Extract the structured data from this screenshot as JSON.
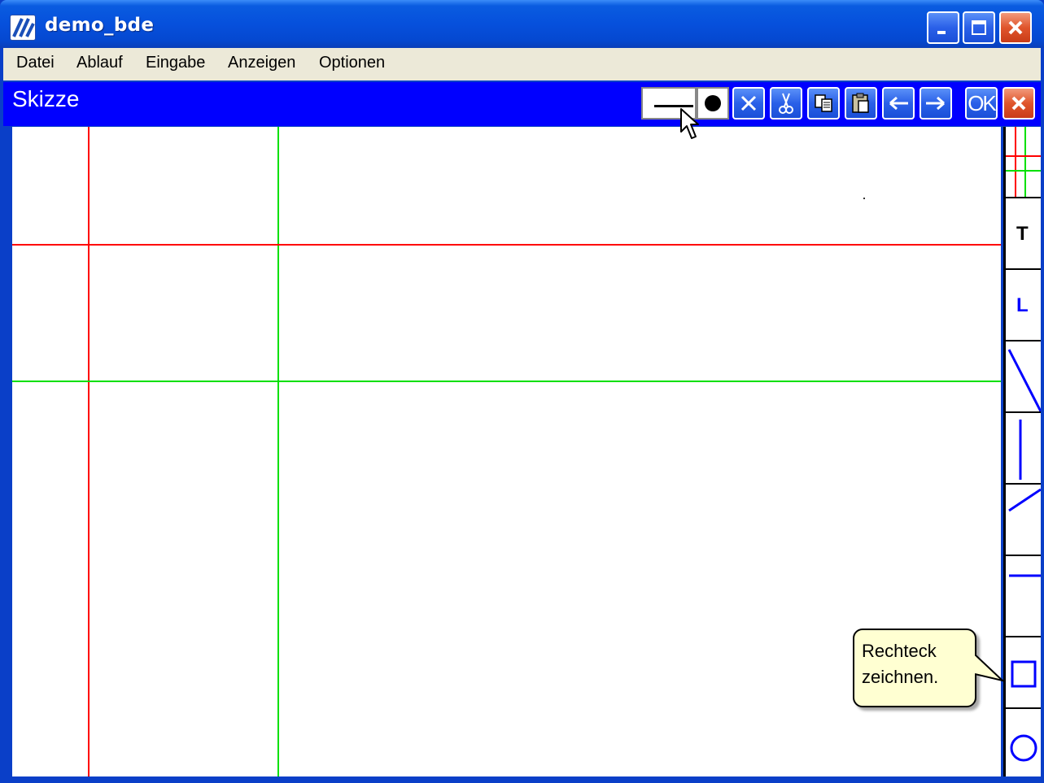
{
  "window": {
    "title": "demo_bde"
  },
  "menu": {
    "items": [
      "Datei",
      "Ablauf",
      "Eingabe",
      "Anzeigen",
      "Optionen"
    ]
  },
  "panel": {
    "title": "Skizze",
    "ok_label": "OK"
  },
  "tooltip": {
    "text": "Rechteck\nzeichnen."
  },
  "toolbox": {
    "text_tool_label": "T",
    "line_tool_label": "L"
  },
  "colors": {
    "title_blue": "#0650dc",
    "panel_blue": "#0000ff",
    "guide_red": "#ff0000",
    "guide_green": "#00e000",
    "tool_blue": "#0000ff"
  }
}
